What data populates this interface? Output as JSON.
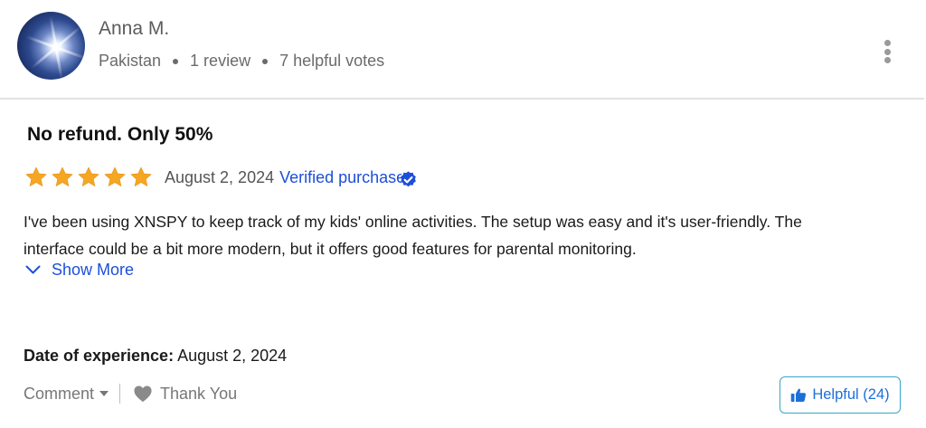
{
  "reviewer": {
    "name": "Anna M.",
    "country": "Pakistan",
    "reviews": "1 review",
    "helpful_votes": "7 helpful votes"
  },
  "review": {
    "title": "No refund. Only 50%",
    "rating": 5,
    "max_rating": 5,
    "date": "August 2, 2024",
    "verified_label": "Verified purchase",
    "body": "I've been using XNSPY to keep track of my kids' online activities. The setup was easy and it's user-friendly. The interface could be a bit more modern, but it offers good features for parental monitoring.",
    "show_more_label": "Show More",
    "experience_label": "Date of experience:",
    "experience_date": "August 2, 2024"
  },
  "actions": {
    "comment_label": "Comment",
    "thank_label": "Thank You",
    "helpful_label": "Helpful (24)"
  },
  "icons": {
    "star": "star-icon",
    "verified": "check-badge-icon",
    "show_more": "chevron-down-icon",
    "comment_caret": "caret-down-icon",
    "thank": "heart-icon",
    "helpful": "thumbs-up-icon",
    "more": "vertical-dots-icon"
  },
  "colors": {
    "star": "#f5a623",
    "link": "#1d4fd8",
    "helpful_border": "#37a7c7",
    "muted": "#777777"
  }
}
